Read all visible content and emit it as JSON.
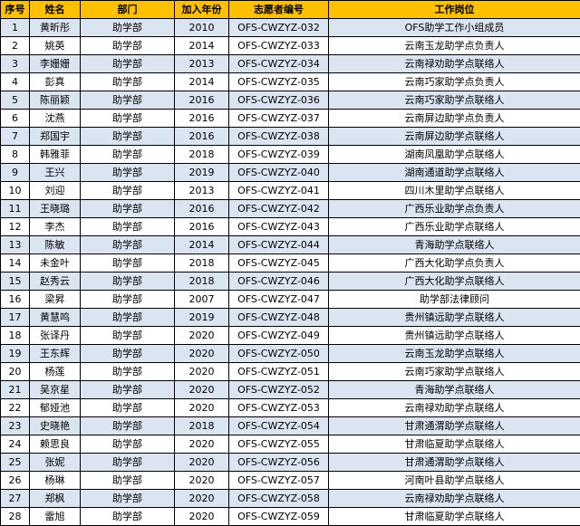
{
  "colors": {
    "header_bg": "#ffc000",
    "row_shade": "#dbe5f1",
    "row_plain": "#ffffff",
    "border": "#000000"
  },
  "headers": [
    "序号",
    "姓名",
    "部门",
    "加入年份",
    "志愿者编号",
    "工作岗位"
  ],
  "rows": [
    [
      "1",
      "黄昕彤",
      "助学部",
      "2010",
      "OFS-CWZYZ-032",
      "OFS助学工作小组成员"
    ],
    [
      "2",
      "姚英",
      "助学部",
      "2014",
      "OFS-CWZYZ-033",
      "云南玉龙助学点负责人"
    ],
    [
      "3",
      "李姗姗",
      "助学部",
      "2013",
      "OFS-CWZYZ-034",
      "云南禄劝助学点联络人"
    ],
    [
      "4",
      "彭真",
      "助学部",
      "2014",
      "OFS-CWZYZ-035",
      "云南巧家助学点负责人"
    ],
    [
      "5",
      "陈丽颖",
      "助学部",
      "2016",
      "OFS-CWZYZ-036",
      "云南巧家助学点联络人"
    ],
    [
      "6",
      "沈燕",
      "助学部",
      "2016",
      "OFS-CWZYZ-037",
      "云南屏边助学点负责人"
    ],
    [
      "7",
      "郑国宇",
      "助学部",
      "2016",
      "OFS-CWZYZ-038",
      "云南屏边助学点联络人"
    ],
    [
      "8",
      "韩雅菲",
      "助学部",
      "2018",
      "OFS-CWZYZ-039",
      "湖南凤凰助学点联络人"
    ],
    [
      "9",
      "王兴",
      "助学部",
      "2019",
      "OFS-CWZYZ-040",
      "湖南通道助学点联络人"
    ],
    [
      "10",
      "刘迎",
      "助学部",
      "2013",
      "OFS-CWZYZ-041",
      "四川木里助学点联络人"
    ],
    [
      "11",
      "王晓璐",
      "助学部",
      "2016",
      "OFS-CWZYZ-042",
      "广西乐业助学点负责人"
    ],
    [
      "12",
      "李杰",
      "助学部",
      "2016",
      "OFS-CWZYZ-043",
      "广西乐业助学点联络人"
    ],
    [
      "13",
      "陈敏",
      "助学部",
      "2014",
      "OFS-CWZYZ-044",
      "青海助学点联络人"
    ],
    [
      "14",
      "未金叶",
      "助学部",
      "2018",
      "OFS-CWZYZ-045",
      "广西大化助学点负责人"
    ],
    [
      "15",
      "赵秀云",
      "助学部",
      "2018",
      "OFS-CWZYZ-046",
      "广西大化助学点联络人"
    ],
    [
      "16",
      "梁昇",
      "助学部",
      "2007",
      "OFS-CWZYZ-047",
      "助学部法律顾问"
    ],
    [
      "17",
      "黄慧鸣",
      "助学部",
      "2019",
      "OFS-CWZYZ-048",
      "贵州镇远助学点联络人"
    ],
    [
      "18",
      "张译丹",
      "助学部",
      "2020",
      "OFS-CWZYZ-049",
      "贵州镇远助学点联络人"
    ],
    [
      "19",
      "王东辉",
      "助学部",
      "2020",
      "OFS-CWZYZ-050",
      "云南玉龙助学点联络人"
    ],
    [
      "20",
      "杨莲",
      "助学部",
      "2020",
      "OFS-CWZYZ-051",
      "云南巧家助学点联络人"
    ],
    [
      "21",
      "吴京星",
      "助学部",
      "2020",
      "OFS-CWZYZ-052",
      "青海助学点联络人"
    ],
    [
      "22",
      "郁娅池",
      "助学部",
      "2020",
      "OFS-CWZYZ-053",
      "云南禄劝助学点联络人"
    ],
    [
      "23",
      "史晓艳",
      "助学部",
      "2018",
      "OFS-CWZYZ-054",
      "甘肃通渭助学点联络人"
    ],
    [
      "24",
      "赖思良",
      "助学部",
      "2020",
      "OFS-CWZYZ-055",
      "甘肃临夏助学点联络人"
    ],
    [
      "25",
      "张妮",
      "助学部",
      "2020",
      "OFS-CWZYZ-056",
      "甘肃通渭助学点联络人"
    ],
    [
      "26",
      "杨琳",
      "助学部",
      "2020",
      "OFS-CWZYZ-057",
      "河南叶县助学点联络人"
    ],
    [
      "27",
      "郑枫",
      "助学部",
      "2020",
      "OFS-CWZYZ-058",
      "云南禄劝助学点联络人"
    ],
    [
      "28",
      "雷旭",
      "助学部",
      "2020",
      "OFS-CWZYZ-059",
      "甘肃临夏助学点联络人"
    ]
  ]
}
